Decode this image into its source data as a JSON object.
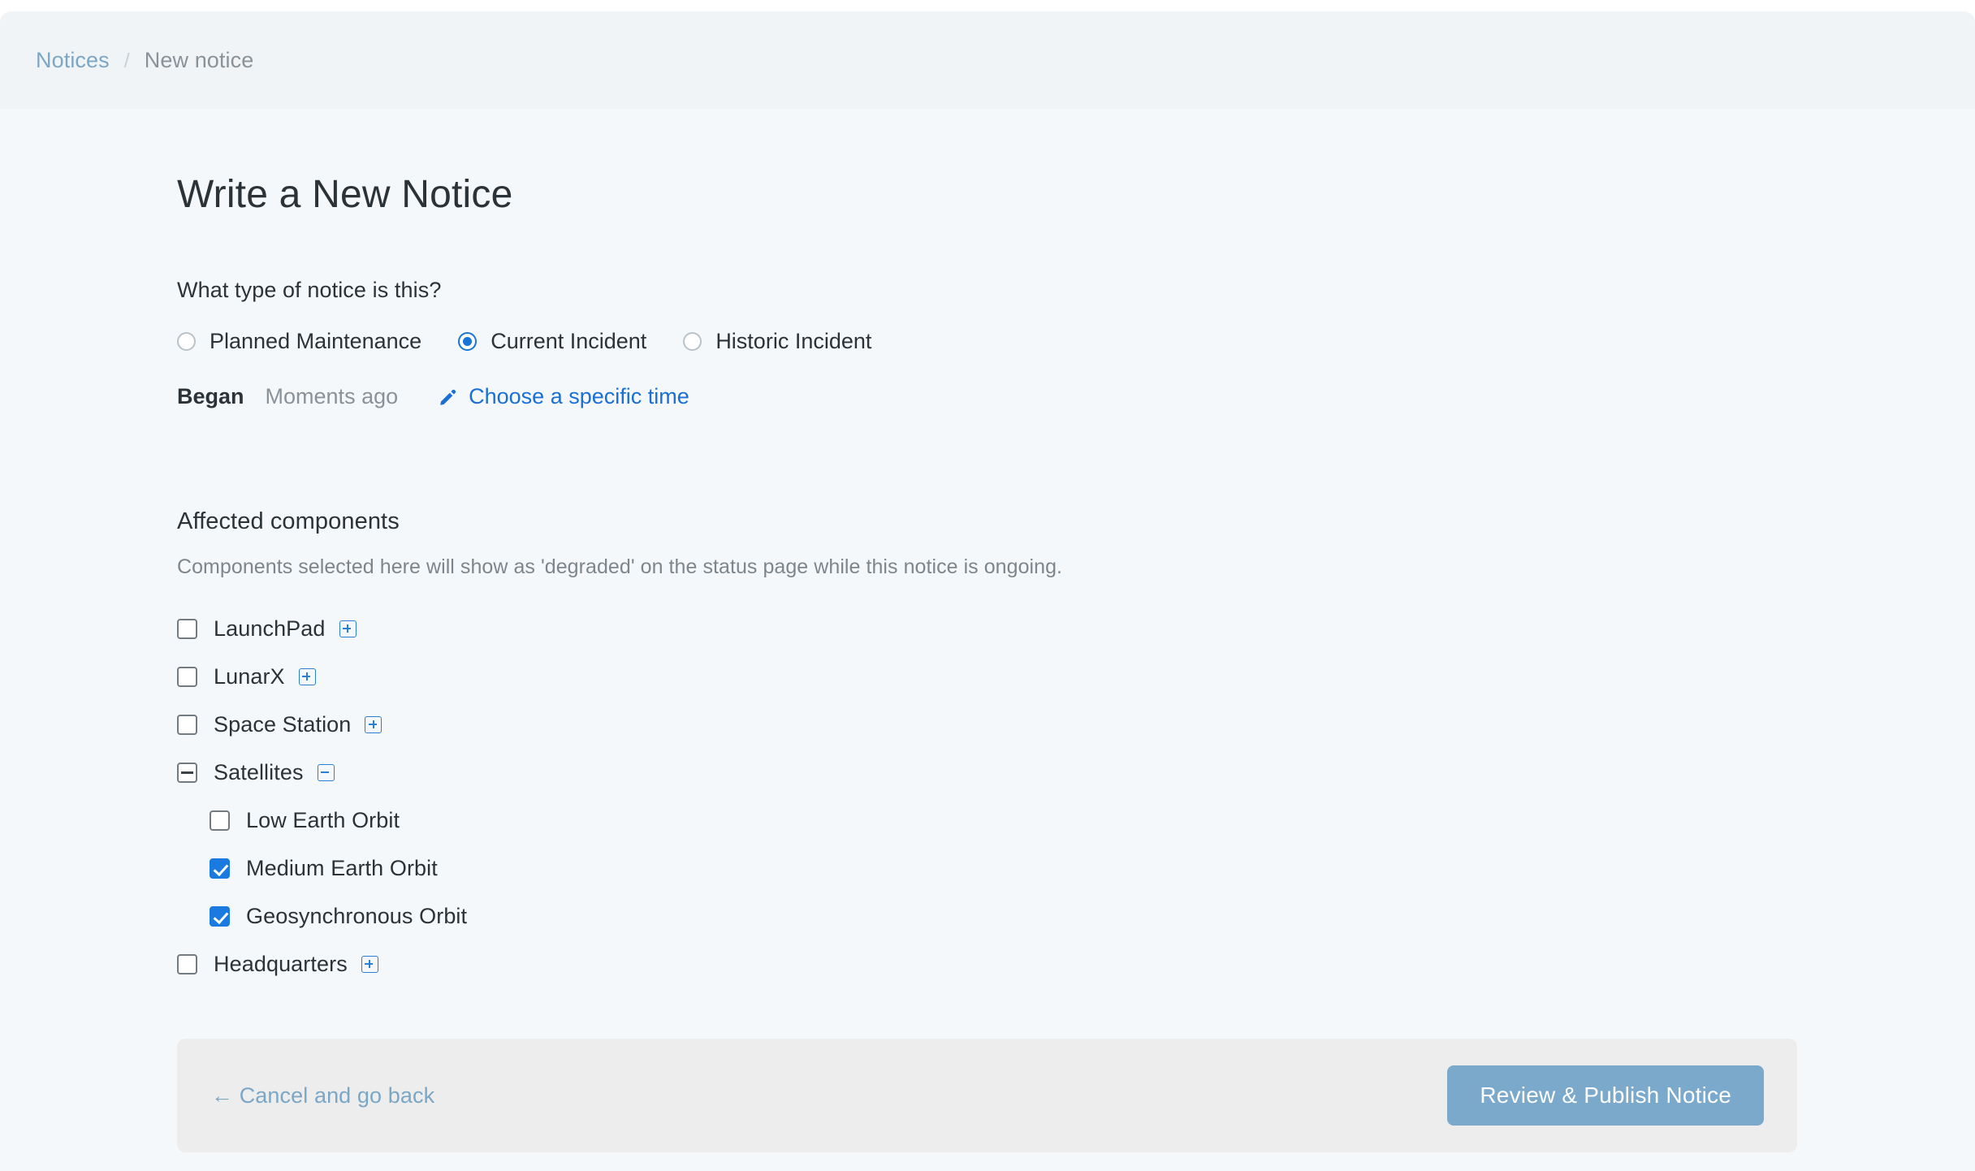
{
  "breadcrumb": {
    "parent": "Notices",
    "separator": "/",
    "current": "New notice"
  },
  "page": {
    "title": "Write a New Notice"
  },
  "notice_type": {
    "label": "What type of notice is this?",
    "options": [
      {
        "label": "Planned Maintenance",
        "selected": false
      },
      {
        "label": "Current Incident",
        "selected": true
      },
      {
        "label": "Historic Incident",
        "selected": false
      }
    ]
  },
  "began": {
    "label": "Began",
    "value": "Moments ago",
    "edit_link": "Choose a specific time",
    "edit_icon": "pencil-icon"
  },
  "affected_components": {
    "title": "Affected components",
    "description": "Components selected here will show as 'degraded' on the status page while this notice is ongoing.",
    "items": [
      {
        "label": "LaunchPad",
        "state": "unchecked",
        "depth": 0,
        "toggle": "plus"
      },
      {
        "label": "LunarX",
        "state": "unchecked",
        "depth": 0,
        "toggle": "plus"
      },
      {
        "label": "Space Station",
        "state": "unchecked",
        "depth": 0,
        "toggle": "plus"
      },
      {
        "label": "Satellites",
        "state": "indeterminate",
        "depth": 0,
        "toggle": "minus"
      },
      {
        "label": "Low Earth Orbit",
        "state": "unchecked",
        "depth": 1,
        "toggle": "none"
      },
      {
        "label": "Medium Earth Orbit",
        "state": "checked",
        "depth": 1,
        "toggle": "none"
      },
      {
        "label": "Geosynchronous Orbit",
        "state": "checked",
        "depth": 1,
        "toggle": "none"
      },
      {
        "label": "Headquarters",
        "state": "unchecked",
        "depth": 0,
        "toggle": "plus"
      }
    ]
  },
  "footer": {
    "cancel_label": "← Cancel and go back",
    "publish_label": "Review & Publish Notice"
  },
  "colors": {
    "accent_blue": "#1a73d9",
    "link_blue": "#1a6fd4",
    "muted_blue": "#7ba7c7",
    "primary_button": "#7aa9cb",
    "page_background": "#f5f8fa",
    "header_background": "#f1f4f6",
    "footer_card": "#eeeded",
    "text_dark": "#2b3338",
    "text_muted": "#8a9299"
  }
}
